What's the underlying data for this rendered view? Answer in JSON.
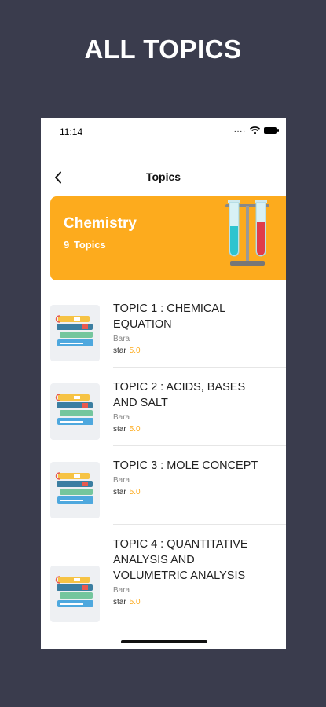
{
  "promo": {
    "title": "ALL TOPICS"
  },
  "status_bar": {
    "time": "11:14",
    "signal": "...."
  },
  "nav": {
    "title": "Topics"
  },
  "subject_card": {
    "name": "Chemistry",
    "count": "9 Topics",
    "color": "#fdab1d"
  },
  "topics": [
    {
      "title": "TOPIC 1 : CHEMICAL EQUATION",
      "author": "Bara",
      "rating_label": "star",
      "rating": "5.0"
    },
    {
      "title": "TOPIC 2 : ACIDS, BASES AND SALT",
      "author": "Bara",
      "rating_label": "star",
      "rating": "5.0"
    },
    {
      "title": "TOPIC 3 : MOLE CONCEPT",
      "author": "Bara",
      "rating_label": "star",
      "rating": "5.0"
    },
    {
      "title": "TOPIC 4 : QUANTITATIVE ANALYSIS AND VOLUMETRIC ANALYSIS",
      "author": "Bara",
      "rating_label": "star",
      "rating": "5.0"
    }
  ],
  "icons": [
    "chevron-left-icon",
    "wifi-icon",
    "battery-icon",
    "test-tubes-icon",
    "books-icon"
  ]
}
